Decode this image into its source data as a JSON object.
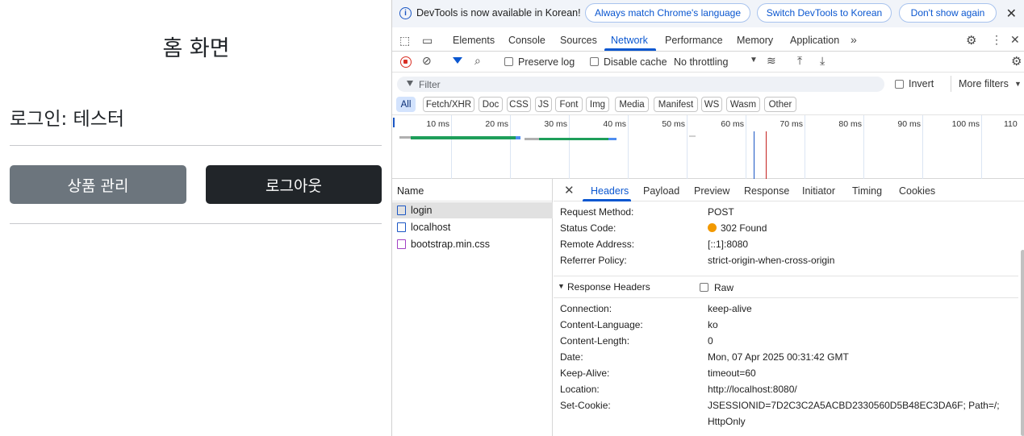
{
  "page": {
    "home_title": "홈 화면",
    "login_line": "로그인: 테스터",
    "btn_products": "상품 관리",
    "btn_logout": "로그아웃"
  },
  "devtools": {
    "infobar": {
      "text": "DevTools is now available in Korean!",
      "btn_match": "Always match Chrome's language",
      "btn_switch": "Switch DevTools to Korean",
      "btn_dont_show": "Don't show again"
    },
    "tabs": [
      "Elements",
      "Console",
      "Sources",
      "Network",
      "Performance",
      "Memory",
      "Application"
    ],
    "active_tab": "Network",
    "toolbar": {
      "preserve_log": "Preserve log",
      "disable_cache": "Disable cache",
      "throttling": "No throttling"
    },
    "filter": {
      "placeholder": "Filter",
      "invert": "Invert",
      "more_filters": "More filters"
    },
    "type_chips": [
      "All",
      "Fetch/XHR",
      "Doc",
      "CSS",
      "JS",
      "Font",
      "Img",
      "Media",
      "Manifest",
      "WS",
      "Wasm",
      "Other"
    ],
    "timeline_labels": [
      "10 ms",
      "20 ms",
      "30 ms",
      "40 ms",
      "50 ms",
      "60 ms",
      "70 ms",
      "80 ms",
      "90 ms",
      "100 ms",
      "110"
    ],
    "name_header": "Name",
    "requests": [
      "login",
      "localhost",
      "bootstrap.min.css"
    ],
    "detail_tabs": [
      "Headers",
      "Payload",
      "Preview",
      "Response",
      "Initiator",
      "Timing",
      "Cookies"
    ],
    "general": [
      {
        "k": "Request Method:",
        "v": "POST"
      },
      {
        "k": "Status Code:",
        "v": "302 Found"
      },
      {
        "k": "Remote Address:",
        "v": "[::1]:8080"
      },
      {
        "k": "Referrer Policy:",
        "v": "strict-origin-when-cross-origin"
      }
    ],
    "response_headers_title": "Response Headers",
    "raw_label": "Raw",
    "response_headers": [
      {
        "k": "Connection:",
        "v": "keep-alive"
      },
      {
        "k": "Content-Language:",
        "v": "ko"
      },
      {
        "k": "Content-Length:",
        "v": "0"
      },
      {
        "k": "Date:",
        "v": "Mon, 07 Apr 2025 00:31:42 GMT"
      },
      {
        "k": "Keep-Alive:",
        "v": "timeout=60"
      },
      {
        "k": "Location:",
        "v": "http://localhost:8080/"
      },
      {
        "k": "Set-Cookie:",
        "v": "JSESSIONID=7D2C3C2A5ACBD2330560D5B48EC3DA6F; Path=/;"
      },
      {
        "k": "",
        "v": "HttpOnly"
      }
    ],
    "colors": {
      "accent": "#0b57d0",
      "record": "#d93025",
      "status_dot": "#f29900"
    }
  }
}
